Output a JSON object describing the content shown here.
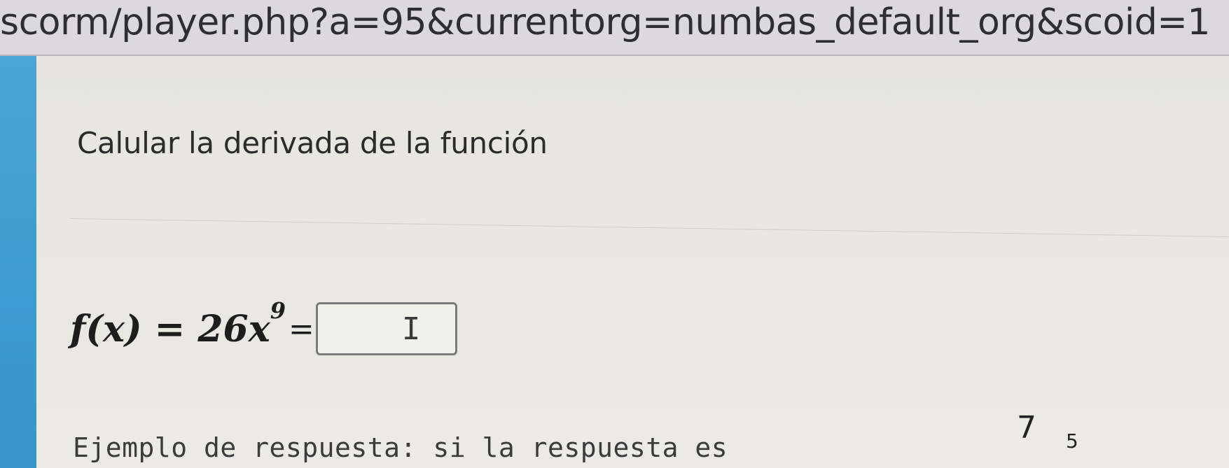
{
  "browser": {
    "url_fragment": "scorm/player.php?a=95&currentorg=numbas_default_org&scoid=1"
  },
  "question": {
    "prompt": "Calular la derivada de la función",
    "formula": {
      "lhs": "f(x) = 26x",
      "exponent": "9",
      "equals": "=",
      "answer_value": "",
      "cursor_glyph": "I"
    },
    "example": {
      "text": "Ejemplo de respuesta: si la respuesta es",
      "fraction_numerator": "7",
      "fraction_exponent": "5"
    }
  },
  "colors": {
    "side_strip": "#3c9bd0",
    "content_bg": "#e9e8e2",
    "url_bar_bg": "#dcd9de"
  }
}
